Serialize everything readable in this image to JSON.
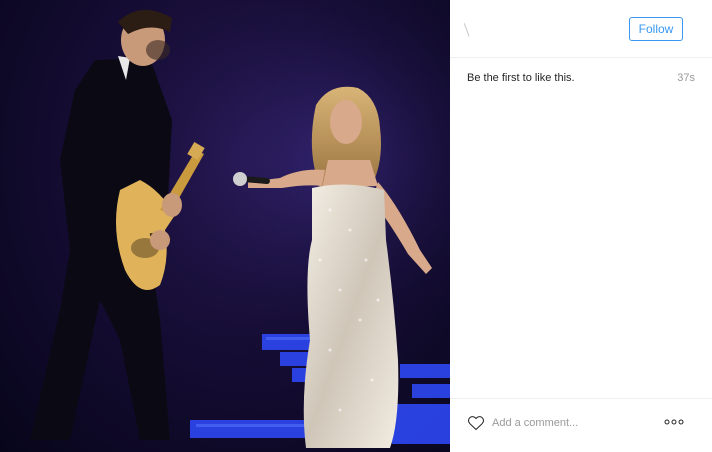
{
  "post": {
    "image_alt": "Concert photo: guitarist in dark suit and singer in sequined white gown holding out a microphone",
    "colors": {
      "stage_dark": "#07051a",
      "stage_purple": "#2a1a5a",
      "stage_blue": "#2f4bff",
      "gown": "#e8e2d8"
    }
  },
  "header": {
    "follow_label": "Follow"
  },
  "likes": {
    "text": "Be the first to like this.",
    "timestamp": "37s"
  },
  "footer": {
    "comment_placeholder": "Add a comment...",
    "heart_icon": "heart-outline-icon",
    "more_icon": "more-dots-icon"
  },
  "accent": "#3897f0"
}
